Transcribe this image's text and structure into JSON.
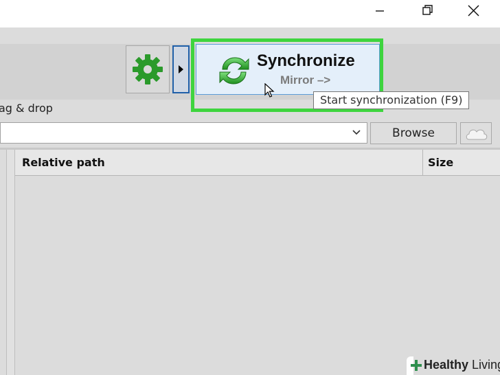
{
  "window": {
    "controls": [
      "minimize-icon",
      "restore-icon",
      "close-icon"
    ]
  },
  "toolbar": {
    "settings_icon": "gear-icon",
    "expand_icon": "triangle-right-icon",
    "sync_button": {
      "title": "Synchronize",
      "subtitle": "Mirror –>",
      "icon": "sync-arrows-icon"
    },
    "tooltip": "Start synchronization (F9)"
  },
  "folder_pane": {
    "drag_drop_label": "ag & drop",
    "path_value": "",
    "browse_label": "Browse",
    "cloud_icon": "cloud-icon"
  },
  "file_grid": {
    "columns": [
      "Relative path",
      "Size"
    ]
  },
  "watermark": {
    "brand_bold": "Healthy",
    "brand_rest": " Living"
  },
  "colors": {
    "highlight": "#3ed43e",
    "sync_button_bg": "#e4effa",
    "sync_button_border": "#5a9bd8",
    "expand_border": "#1f5fa8",
    "gear_green": "#2b9a2b"
  }
}
